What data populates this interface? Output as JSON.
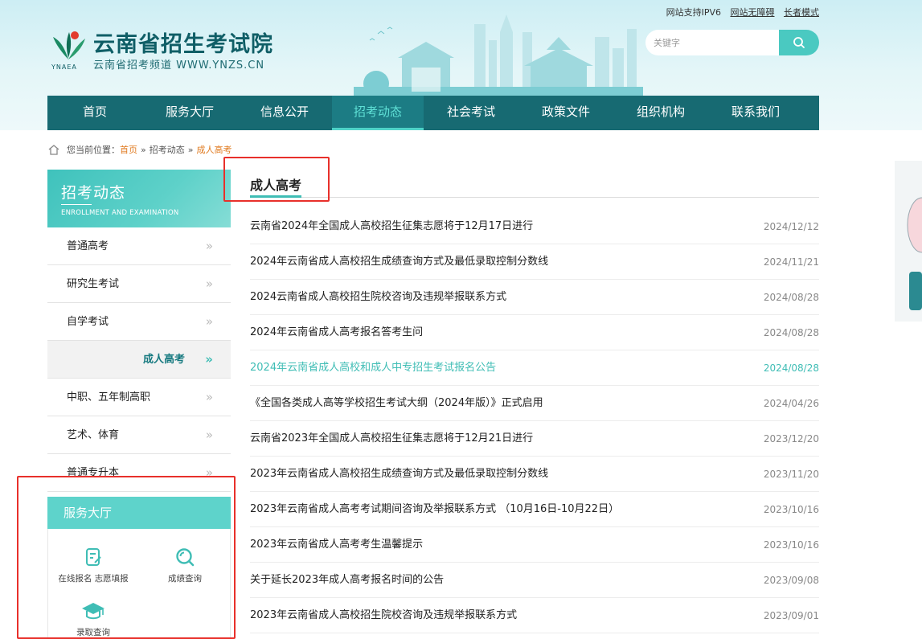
{
  "header": {
    "site_name": "云南省招生考试院",
    "site_sub": "云南省招考频道 WWW.YNZS.CN",
    "logo_abbr": "YNAEA",
    "top_links": [
      "网站支持IPV6",
      "网站无障碍",
      "长者模式"
    ],
    "search_placeholder": "关键字"
  },
  "nav": [
    "首页",
    "服务大厅",
    "信息公开",
    "招考动态",
    "社会考试",
    "政策文件",
    "组织机构",
    "联系我们"
  ],
  "nav_active_index": 3,
  "breadcrumb": {
    "prefix": "您当前位置：",
    "items": [
      "首页",
      "招考动态",
      "成人高考"
    ]
  },
  "sidebar": {
    "title": "招考动态",
    "subtitle": "ENROLLMENT AND EXAMINATION",
    "items": [
      {
        "label": "普通高考"
      },
      {
        "label": "研究生考试"
      },
      {
        "label": "自学考试"
      },
      {
        "label": "成人高考",
        "active": true
      },
      {
        "label": "中职、五年制高职"
      },
      {
        "label": "艺术、体育"
      },
      {
        "label": "普通专升本"
      }
    ],
    "chevron": "»"
  },
  "service": {
    "title": "服务大厅",
    "items": [
      {
        "label": "在线报名 志愿填报",
        "icon": "form-edit-icon"
      },
      {
        "label": "成绩查询",
        "icon": "search-score-icon"
      },
      {
        "label": "录取查询",
        "icon": "graduation-cap-icon"
      }
    ]
  },
  "main": {
    "section_title": "成人高考",
    "news": [
      {
        "title": "云南省2024年全国成人高校招生征集志愿将于12月17日进行",
        "date": "2024/12/12"
      },
      {
        "title": "2024年云南省成人高校招生成绩查询方式及最低录取控制分数线",
        "date": "2024/11/21"
      },
      {
        "title": "2024云南省成人高校招生院校咨询及违规举报联系方式",
        "date": "2024/08/28"
      },
      {
        "title": "2024年云南省成人高考报名答考生问",
        "date": "2024/08/28"
      },
      {
        "title": "2024年云南省成人高校和成人中专招生考试报名公告",
        "date": "2024/08/28",
        "hot": true
      },
      {
        "title": "《全国各类成人高等学校招生考试大纲（2024年版）》正式启用",
        "date": "2024/04/26"
      },
      {
        "title": "云南省2023年全国成人高校招生征集志愿将于12月21日进行",
        "date": "2023/12/20"
      },
      {
        "title": "2023年云南省成人高校招生成绩查询方式及最低录取控制分数线",
        "date": "2023/11/20"
      },
      {
        "title": "2023年云南省成人高考考试期间咨询及举报联系方式 （10月16日-10月22日）",
        "date": "2023/10/16"
      },
      {
        "title": "2023年云南省成人高考考生温馨提示",
        "date": "2023/10/16"
      },
      {
        "title": "关于延长2023年成人高考报名时间的公告",
        "date": "2023/09/08"
      },
      {
        "title": "2023年云南省成人高校招生院校咨询及违规举报联系方式",
        "date": "2023/09/01"
      }
    ]
  },
  "colors": {
    "nav_bg": "#176a72",
    "accent": "#3fbdb5",
    "highlight_box": "#e8302b",
    "breadcrumb_link": "#e07b21"
  }
}
